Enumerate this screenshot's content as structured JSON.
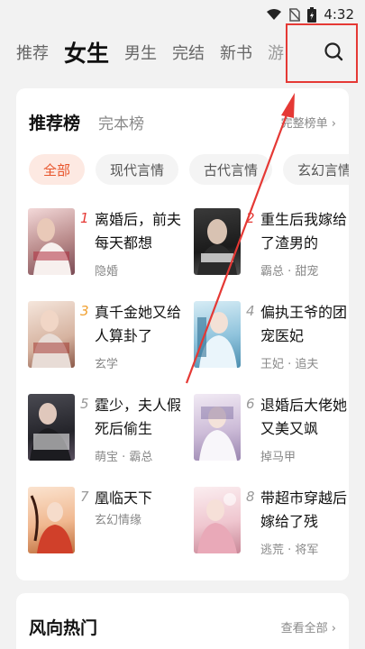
{
  "status": {
    "time": "4:32"
  },
  "nav": {
    "tabs": [
      "推荐",
      "女生",
      "男生",
      "完结",
      "新书",
      "游"
    ],
    "active_index": 1
  },
  "ranking": {
    "title": "推荐榜",
    "subtitle": "完本榜",
    "more": "完整榜单 ›",
    "chips": [
      "全部",
      "现代言情",
      "古代言情",
      "玄幻言情"
    ],
    "books": [
      {
        "rank": "1",
        "title": "离婚后，前夫每天都想",
        "tags": "隐婚"
      },
      {
        "rank": "2",
        "title": "重生后我嫁给了渣男的",
        "tags": "霸总 · 甜宠"
      },
      {
        "rank": "3",
        "title": "真千金她又给人算卦了",
        "tags": "玄学"
      },
      {
        "rank": "4",
        "title": "偏执王爷的团宠医妃",
        "tags": "王妃 · 追夫"
      },
      {
        "rank": "5",
        "title": "霆少，夫人假死后偷生",
        "tags": "萌宝 · 霸总"
      },
      {
        "rank": "6",
        "title": "退婚后大佬她又美又飒",
        "tags": "掉马甲"
      },
      {
        "rank": "7",
        "title": "凰临天下",
        "tags": "玄幻情缘"
      },
      {
        "rank": "8",
        "title": "带超市穿越后嫁给了残",
        "tags": "逃荒 · 将军"
      }
    ]
  },
  "trending": {
    "title": "风向热门",
    "more": "查看全部 ›"
  },
  "colors": {
    "accent": "#e8542b",
    "rank_top": "#e53935",
    "rank_third": "#f0a030",
    "rank_other": "#999999",
    "highlight_box": "#e53935"
  }
}
